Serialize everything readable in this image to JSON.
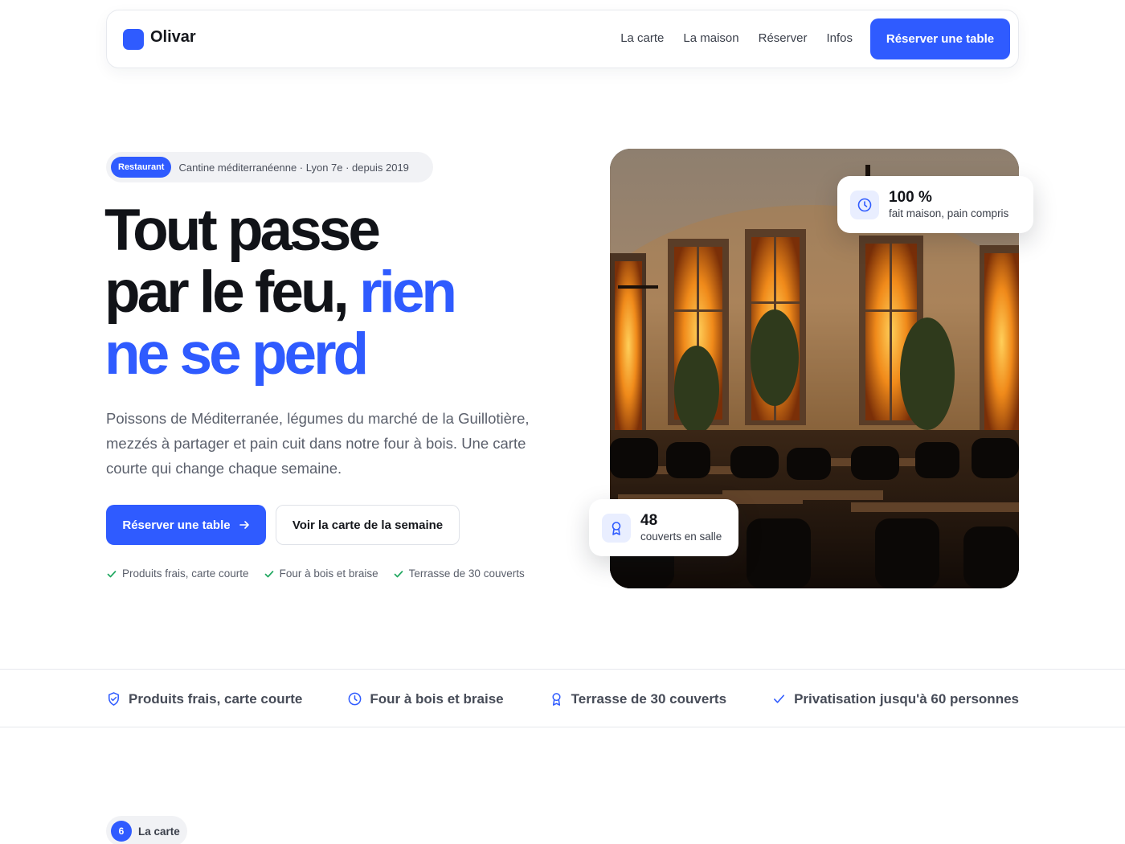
{
  "theme": {
    "accent": "#2f5bff",
    "success": "#22a861",
    "text": "#111318",
    "muted": "#5a5f6b"
  },
  "nav": {
    "brand": "Olivar",
    "links": [
      "La carte",
      "La maison",
      "Réserver",
      "Infos"
    ],
    "cta": "Réserver une table"
  },
  "hero": {
    "badge": "Restaurant",
    "tagline": "Cantine méditerranéenne · Lyon 7e · depuis 2019",
    "headline": {
      "line1": "Tout passe",
      "line2a": "par le feu,",
      "line2b": "rien",
      "line3": "ne se perd"
    },
    "lead": "Poissons de Méditerranée, légumes du marché de la Guillotière, mezzés à partager et pain cuit dans notre four à bois. Une carte courte qui change chaque semaine.",
    "primary_cta": "Réserver une table",
    "primary_cta_icon": "arrow-right-icon",
    "secondary_cta": "Voir la carte de la semaine",
    "checks": [
      "Produits frais, carte courte",
      "Four à bois et braise",
      "Terrasse de 30 couverts"
    ]
  },
  "stats": {
    "top": {
      "value": "100 %",
      "label": "fait maison, pain compris",
      "icon": "clock-icon"
    },
    "bottom": {
      "value": "48",
      "label": "couverts en salle",
      "icon": "award-icon"
    }
  },
  "features": [
    {
      "label": "Produits frais, carte courte",
      "icon": "shield-check-icon"
    },
    {
      "label": "Four à bois et braise",
      "icon": "clock-icon"
    },
    {
      "label": "Terrasse de 30 couverts",
      "icon": "award-icon"
    },
    {
      "label": "Privatisation jusqu'à 60 personnes",
      "icon": "check-icon"
    }
  ],
  "next_section": {
    "number": "6",
    "label": "La carte"
  }
}
